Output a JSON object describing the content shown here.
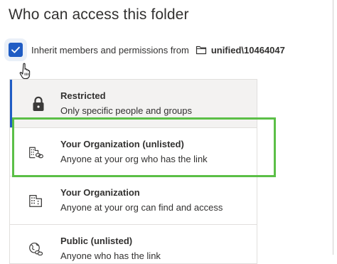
{
  "dialog": {
    "title": "Who can access this folder"
  },
  "inherit": {
    "checked": true,
    "label": "Inherit members and permissions from",
    "folder_icon": "folder-icon",
    "folder_path": "unified\\10464047"
  },
  "options": [
    {
      "id": "restricted",
      "title": "Restricted",
      "description": "Only specific people and groups",
      "icon": "lock-icon",
      "selected": true
    },
    {
      "id": "org-unlisted",
      "title": "Your Organization (unlisted)",
      "description": "Anyone at your org who has the link",
      "icon": "building-link-icon",
      "selected": false
    },
    {
      "id": "org",
      "title": "Your Organization",
      "description": "Anyone at your org can find and access",
      "icon": "building-icon",
      "selected": false
    },
    {
      "id": "public-unlisted",
      "title": "Public (unlisted)",
      "description": "Anyone who has the link",
      "icon": "globe-link-icon",
      "selected": false
    }
  ],
  "colors": {
    "accent": "#1f5cc4",
    "highlight": "#5bbf47",
    "selected_bg": "#f3f2f1"
  }
}
